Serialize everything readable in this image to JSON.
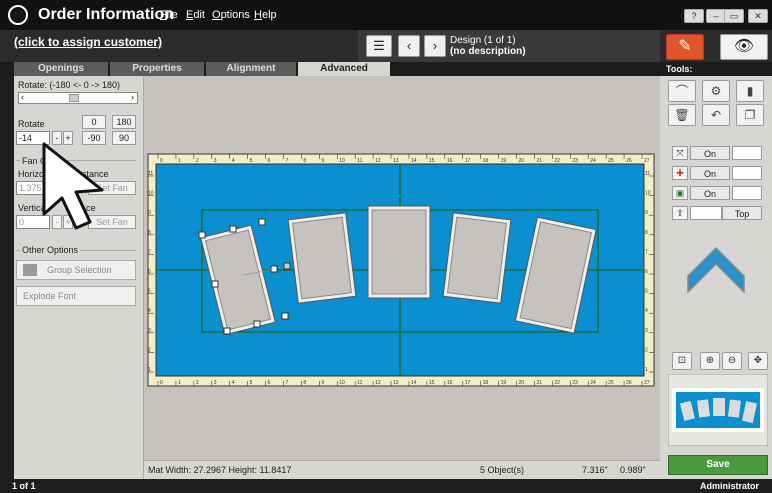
{
  "app": {
    "logo": "@",
    "title": "Order Information"
  },
  "menu": [
    {
      "label": "File",
      "key": "F",
      "rest": "ile"
    },
    {
      "label": "Edit",
      "key": "E",
      "rest": "dit"
    },
    {
      "label": "Options",
      "key": "O",
      "rest": "ptions"
    },
    {
      "label": "Help",
      "key": "H",
      "rest": "elp"
    }
  ],
  "window_buttons": {
    "help": "?",
    "minimize": "–",
    "restore": "▭",
    "close": "✕"
  },
  "customer_link": "(click to assign customer)",
  "design": {
    "title": "Design  (1 of 1)",
    "description": "(no description)"
  },
  "tabs": [
    "Openings",
    "Properties",
    "Alignment",
    "Advanced"
  ],
  "active_tab": "Advanced",
  "tools_label": "Tools:",
  "left": {
    "rotate_range_label": "Rotate: (-180 <- 0 -> 180)",
    "rotate_label": "Rotate",
    "rotate_value": "-14",
    "btn_0": "0",
    "btn_180": "180",
    "btn_minus": "-",
    "btn_plus": "+",
    "btn_neg90": "-90",
    "btn_90": "90",
    "fan_label": "Fan C",
    "horiz_label": "Horizo",
    "distance_label": "stance",
    "horiz_value": "1.375",
    "set_fan": "Set Fan",
    "vert_label": "Vertica",
    "vert_label2": "ce",
    "vert_value": "0",
    "other_options": "Other Options",
    "group_selection": "Group Selection",
    "explode_font": "Explode Font"
  },
  "ruler": {
    "x_ticks": [
      "0",
      "1",
      "2",
      "3",
      "4",
      "5",
      "6",
      "7",
      "8",
      "9",
      "10",
      "11",
      "12",
      "13",
      "14",
      "15",
      "16",
      "17",
      "18",
      "19",
      "20",
      "21",
      "22",
      "23",
      "24",
      "25",
      "26",
      "27"
    ],
    "y_ticks": [
      "1",
      "2",
      "3",
      "4",
      "5",
      "6",
      "7",
      "8",
      "9",
      "10",
      "11"
    ]
  },
  "status": {
    "mat": "Mat  Width: 27.2967  Height: 11.8417",
    "objects": "5 Object(s)",
    "x": "7.316\"",
    "y": "0.989\""
  },
  "bottom": {
    "page": "1 of 1",
    "user": "Administrator"
  },
  "right": {
    "toggles": [
      {
        "label": "On"
      },
      {
        "label": "On"
      },
      {
        "label": "On"
      }
    ],
    "top_label": "Top",
    "save": "Save"
  },
  "colors": {
    "mat": "#0a8fd0",
    "accent": "#e2532a",
    "save": "#4a9a3d",
    "chevron": "#2a92c8"
  }
}
